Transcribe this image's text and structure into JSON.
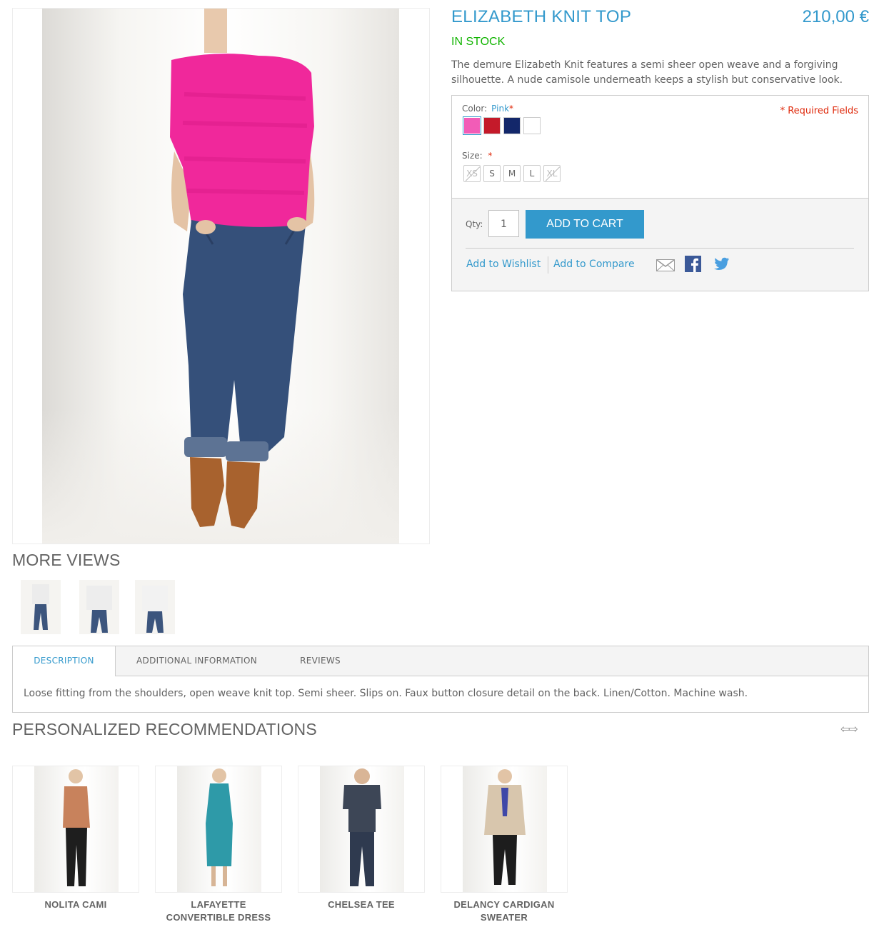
{
  "product": {
    "name": "ELIZABETH KNIT TOP",
    "price": "210,00 €",
    "stock": "IN STOCK",
    "short_description": "The demure Elizabeth Knit features a semi sheer open weave and a forgiving silhouette. A nude camisole underneath keeps a stylish but conservative look."
  },
  "gallery": {
    "more_views_title": "MORE VIEWS",
    "thumbnails": [
      "thumbnail-1",
      "thumbnail-2",
      "thumbnail-3"
    ]
  },
  "options": {
    "color_label": "Color:",
    "color_selected": "Pink",
    "required_star": "*",
    "required_fields": "* Required Fields",
    "colors": [
      {
        "name": "Pink",
        "hex": "#f25cb7",
        "selected": true
      },
      {
        "name": "Red",
        "hex": "#c41a2a",
        "selected": false
      },
      {
        "name": "Navy",
        "hex": "#13276a",
        "selected": false
      },
      {
        "name": "White",
        "hex": "#ffffff",
        "selected": false
      }
    ],
    "size_label": "Size:",
    "sizes": [
      {
        "label": "XS",
        "available": false
      },
      {
        "label": "S",
        "available": true
      },
      {
        "label": "M",
        "available": true
      },
      {
        "label": "L",
        "available": true
      },
      {
        "label": "XL",
        "available": false
      }
    ]
  },
  "cart": {
    "qty_label": "Qty:",
    "qty_value": "1",
    "add_to_cart": "ADD TO CART",
    "wishlist": "Add to Wishlist",
    "compare": "Add to Compare",
    "share_icons": [
      "email-icon",
      "facebook-icon",
      "twitter-icon"
    ]
  },
  "tabs": {
    "items": [
      "DESCRIPTION",
      "ADDITIONAL INFORMATION",
      "REVIEWS"
    ],
    "active": "DESCRIPTION",
    "description": "Loose fitting from the shoulders, open weave knit top. Semi sheer. Slips on. Faux button closure detail on the back. Linen/Cotton. Machine wash."
  },
  "recommendations": {
    "title": "PERSONALIZED RECOMMENDATIONS",
    "items": [
      {
        "name_line1": "NOLITA CAMI",
        "name_line2": ""
      },
      {
        "name_line1": "LAFAYETTE",
        "name_line2": "CONVERTIBLE DRESS"
      },
      {
        "name_line1": "CHELSEA TEE",
        "name_line2": ""
      },
      {
        "name_line1": "DELANCY CARDIGAN",
        "name_line2": "SWEATER"
      }
    ]
  },
  "colors": {
    "accent": "#3399cc",
    "in_stock": "#11b400",
    "required": "#df280a",
    "text": "#636363"
  }
}
